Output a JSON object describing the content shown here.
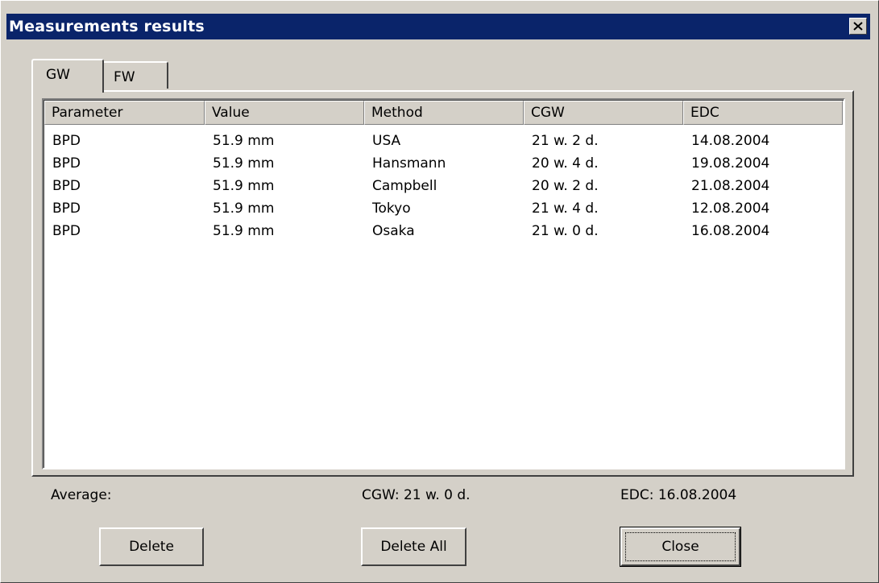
{
  "window": {
    "title": "Measurements results"
  },
  "tabs": [
    {
      "label": "GW",
      "selected": true
    },
    {
      "label": "FW",
      "selected": false
    }
  ],
  "table": {
    "columns": [
      "Parameter",
      "Value",
      "Method",
      "CGW",
      "EDC"
    ],
    "rows": [
      [
        "BPD",
        "51.9 mm",
        "USA",
        "21 w. 2 d.",
        "14.08.2004"
      ],
      [
        "BPD",
        "51.9 mm",
        "Hansmann",
        "20 w. 4 d.",
        "19.08.2004"
      ],
      [
        "BPD",
        "51.9 mm",
        "Campbell",
        "20 w. 2 d.",
        "21.08.2004"
      ],
      [
        "BPD",
        "51.9 mm",
        "Tokyo",
        "21 w. 4 d.",
        "12.08.2004"
      ],
      [
        "BPD",
        "51.9 mm",
        "Osaka",
        "21 w. 0 d.",
        "16.08.2004"
      ]
    ]
  },
  "summary": {
    "average_label": "Average:",
    "cgw": "CGW:  21 w. 0 d.",
    "edc": "EDC:  16.08.2004"
  },
  "buttons": {
    "delete": "Delete",
    "delete_all": "Delete All",
    "close": "Close"
  },
  "colors": {
    "titlebar": "#0a246a",
    "face": "#d4d0c8"
  },
  "icons": {
    "close": "close-icon"
  }
}
